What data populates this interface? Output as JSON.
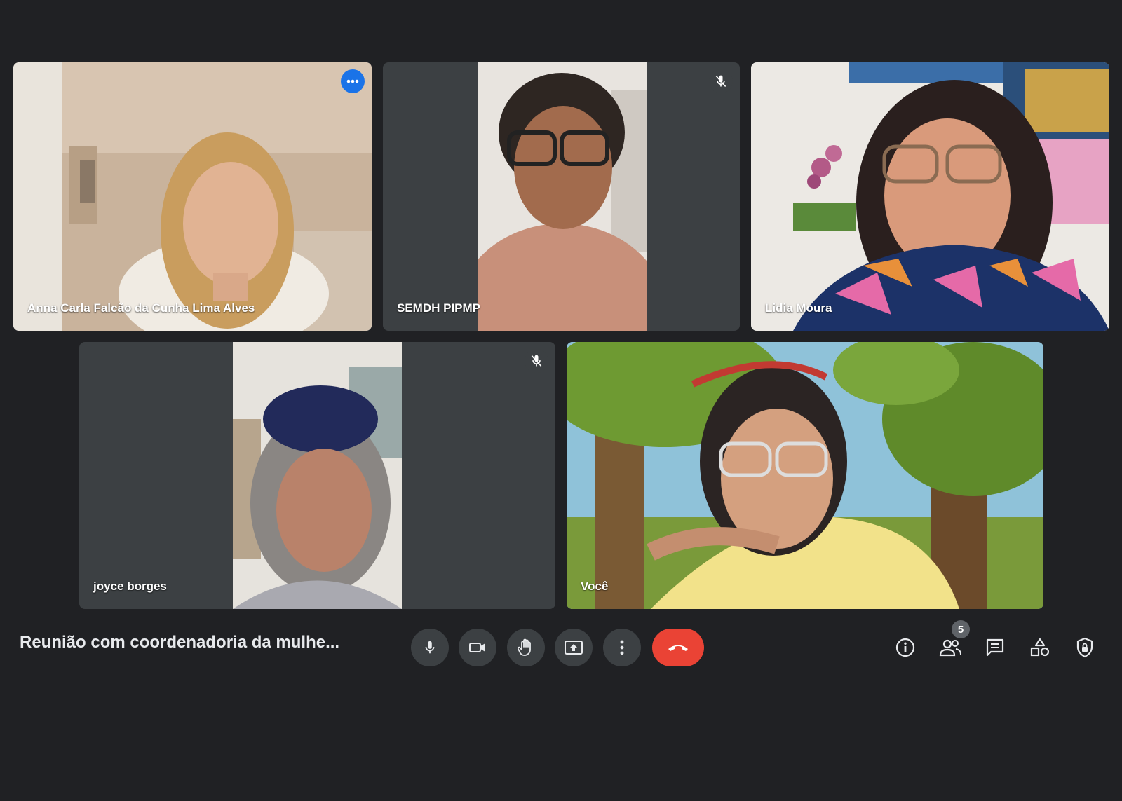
{
  "meeting": {
    "title": "Reunião com coordenadoria da mulhe..."
  },
  "participants": [
    {
      "name": "Anna Carla Falcão da Cunha Lima Alves",
      "muted": false,
      "active_speaker": true
    },
    {
      "name": "SEMDH PIPMP",
      "muted": true,
      "active_speaker": false
    },
    {
      "name": "Lidia Moura",
      "muted": false,
      "active_speaker": false
    },
    {
      "name": "joyce borges",
      "muted": true,
      "active_speaker": false
    },
    {
      "name": "Você",
      "muted": false,
      "active_speaker": false
    }
  ],
  "controls": [
    {
      "name": "microphone",
      "icon": "microphone-icon"
    },
    {
      "name": "camera",
      "icon": "video-camera-icon"
    },
    {
      "name": "raise-hand",
      "icon": "hand-icon"
    },
    {
      "name": "present-screen",
      "icon": "present-screen-icon"
    },
    {
      "name": "more-options",
      "icon": "more-vertical-icon"
    },
    {
      "name": "leave-call",
      "icon": "hang-up-icon"
    }
  ],
  "side_panel": {
    "people_count": "5",
    "icons": [
      "info-icon",
      "people-icon",
      "chat-icon",
      "activities-icon",
      "host-controls-icon"
    ]
  },
  "colors": {
    "background": "#202124",
    "tile": "#3c4043",
    "active_outline": "#8ab4f8",
    "leave_button": "#ea4335",
    "more_badge": "#1a73e8"
  }
}
